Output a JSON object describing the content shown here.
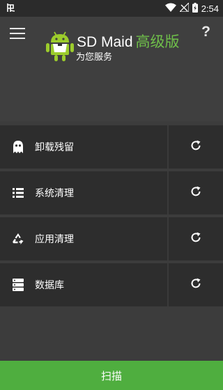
{
  "status_bar": {
    "time": "2:54",
    "icons": [
      "app-notification-icon",
      "wifi-icon",
      "no-signal-icon",
      "battery-charging-icon"
    ]
  },
  "header": {
    "app_name": "SD Maid",
    "edition": "高级版",
    "tagline": "为您服务",
    "help_label": "?",
    "colors": {
      "edition": "#6fbf4a"
    }
  },
  "tools": [
    {
      "label": "卸载残留",
      "icon": "ghost-icon"
    },
    {
      "label": "系统清理",
      "icon": "list-icon"
    },
    {
      "label": "应用清理",
      "icon": "recycle-icon"
    },
    {
      "label": "数据库",
      "icon": "database-icon"
    }
  ],
  "scan_button": {
    "label": "扫描",
    "color": "#4fae3f"
  }
}
